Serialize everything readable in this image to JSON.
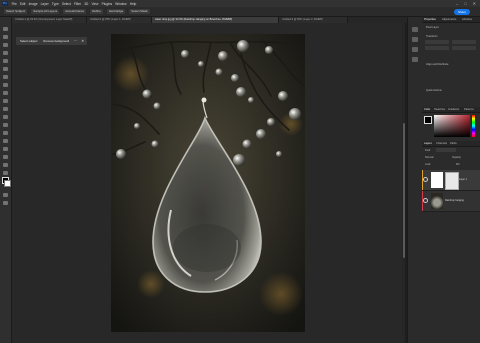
{
  "app": {
    "name": "Photoshop",
    "logo_text": "Ps",
    "menu": [
      "File",
      "Edit",
      "Image",
      "Layer",
      "Type",
      "Select",
      "Filter",
      "3D",
      "View",
      "Plugins",
      "Window",
      "Help"
    ],
    "window_controls": [
      "–",
      "□",
      "✕"
    ]
  },
  "options_bar": {
    "items": [
      "Select Subject",
      "Sample All Layers",
      "Auto-Enhance",
      "Refine",
      "Hard Edge",
      "Select Mask"
    ],
    "share_label": "Share"
  },
  "tabs": [
    {
      "label": "Untitled-1 @ 33.3% (Overexposed, Layer Mask/8)",
      "active": false
    },
    {
      "label": "Untitled-2 @ 25% (Layer 1, RGB/8)",
      "active": false
    },
    {
      "label": "water drop.jpg @ 33.3% (Raindrop Hanging on Branches, RGB/8#)",
      "active": true
    },
    {
      "label": "Untitled-3 @ 50% (Layer 2, RGB/8)",
      "active": false
    }
  ],
  "context_bar": {
    "select_subject": "Select subject",
    "remove_background": "Remove background",
    "icons": [
      "more-icon",
      "close-icon"
    ]
  },
  "panels": {
    "top_tabs": [
      "Properties",
      "Adjustments",
      "Libraries"
    ],
    "sub_sections": [
      "Pixel Layer",
      "Transform",
      "Align and Distribute",
      "Quick Actions"
    ],
    "color_tabs": [
      "Color",
      "Swatches",
      "Gradients",
      "Patterns"
    ],
    "layers_tabs": [
      "Layers",
      "Channels",
      "Paths"
    ],
    "layer_controls": [
      "Kind",
      "Normal",
      "Opacity",
      "Lock",
      "Fill"
    ],
    "layers": [
      {
        "name": "Layer 1",
        "visible": true,
        "color": "#e3a02c"
      },
      {
        "name": "Raindrop hanging",
        "visible": true,
        "color": "#d9394e"
      }
    ]
  },
  "colors": {
    "accent": "#1473e6",
    "panel_bg": "#2b2b2b",
    "canvas_bg": "#282828",
    "foreground_swatch": "#000000",
    "background_swatch": "#ffffff",
    "color_picker_hue": "#b8232e"
  }
}
